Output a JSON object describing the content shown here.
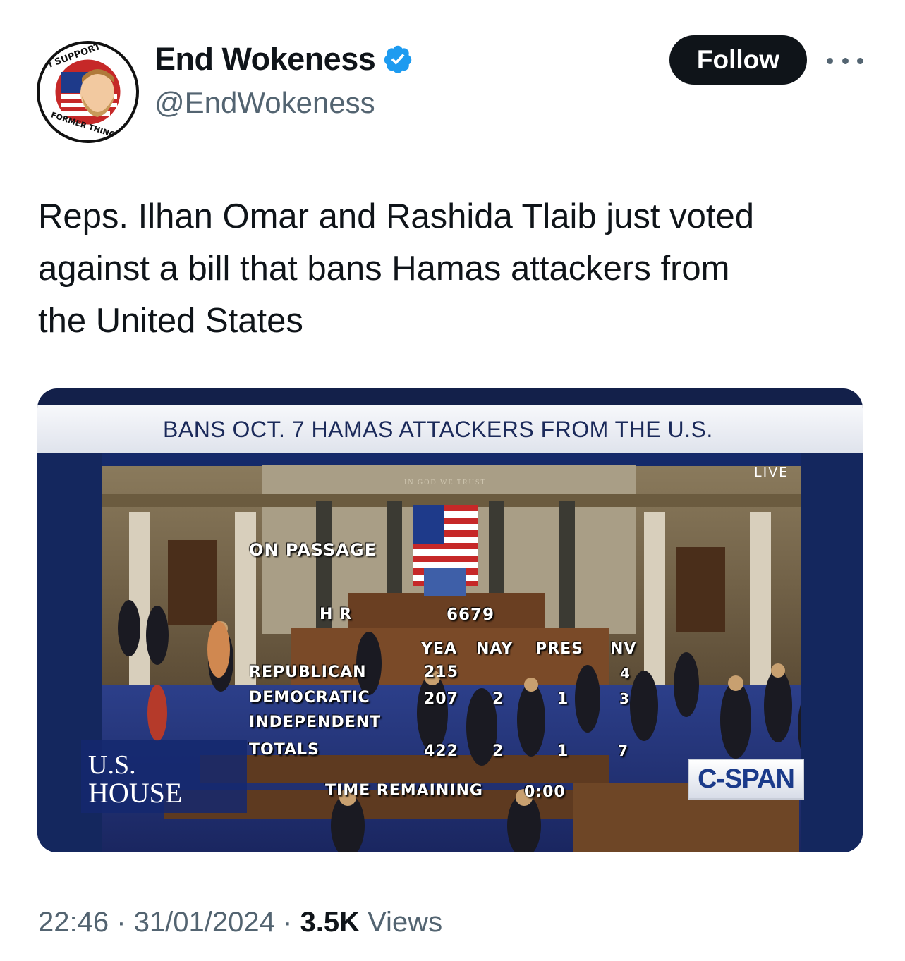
{
  "author": {
    "display_name": "End Wokeness",
    "handle": "@EndWokeness",
    "avatar_text_top": "I SUPPORT THE",
    "avatar_text_bottom": "FORMER THINGS",
    "verified": true
  },
  "actions": {
    "follow_label": "Follow",
    "more_icon": "more-horizontal-icon"
  },
  "tweet": {
    "text": "Reps. Ilhan Omar and Rashida Tlaib just voted\nagainst a bill that bans Hamas attackers from\nthe United States"
  },
  "media": {
    "banner": "BANS OCT. 7 HAMAS ATTACKERS FROM THE U.S.",
    "live": "LIVE",
    "motto": "IN GOD WE TRUST",
    "on_passage": "ON PASSAGE",
    "bill_prefix": "H R",
    "bill_number": "6679",
    "headers": [
      "YEA",
      "NAY",
      "PRES",
      "NV"
    ],
    "rows": [
      {
        "label": "REPUBLICAN",
        "yea": "215",
        "nay": "",
        "pres": "",
        "nv": "4"
      },
      {
        "label": "DEMOCRATIC",
        "yea": "207",
        "nay": "2",
        "pres": "1",
        "nv": "3"
      },
      {
        "label": "INDEPENDENT",
        "yea": "",
        "nay": "",
        "pres": "",
        "nv": ""
      },
      {
        "label": "TOTALS",
        "yea": "422",
        "nay": "2",
        "pres": "1",
        "nv": "7"
      }
    ],
    "time_remaining_label": "TIME REMAINING",
    "time_remaining_value": "0:00",
    "network_line1": "U.S.",
    "network_line2": "HOUSE",
    "cspan": "C-SPAN"
  },
  "meta": {
    "time": "22:46",
    "date": "31/01/2024",
    "views_count": "3.5K",
    "views_label": "Views",
    "separator": "·"
  },
  "colors": {
    "follow_bg": "#0f1419",
    "verified": "#1d9bf0",
    "muted": "#536471"
  }
}
